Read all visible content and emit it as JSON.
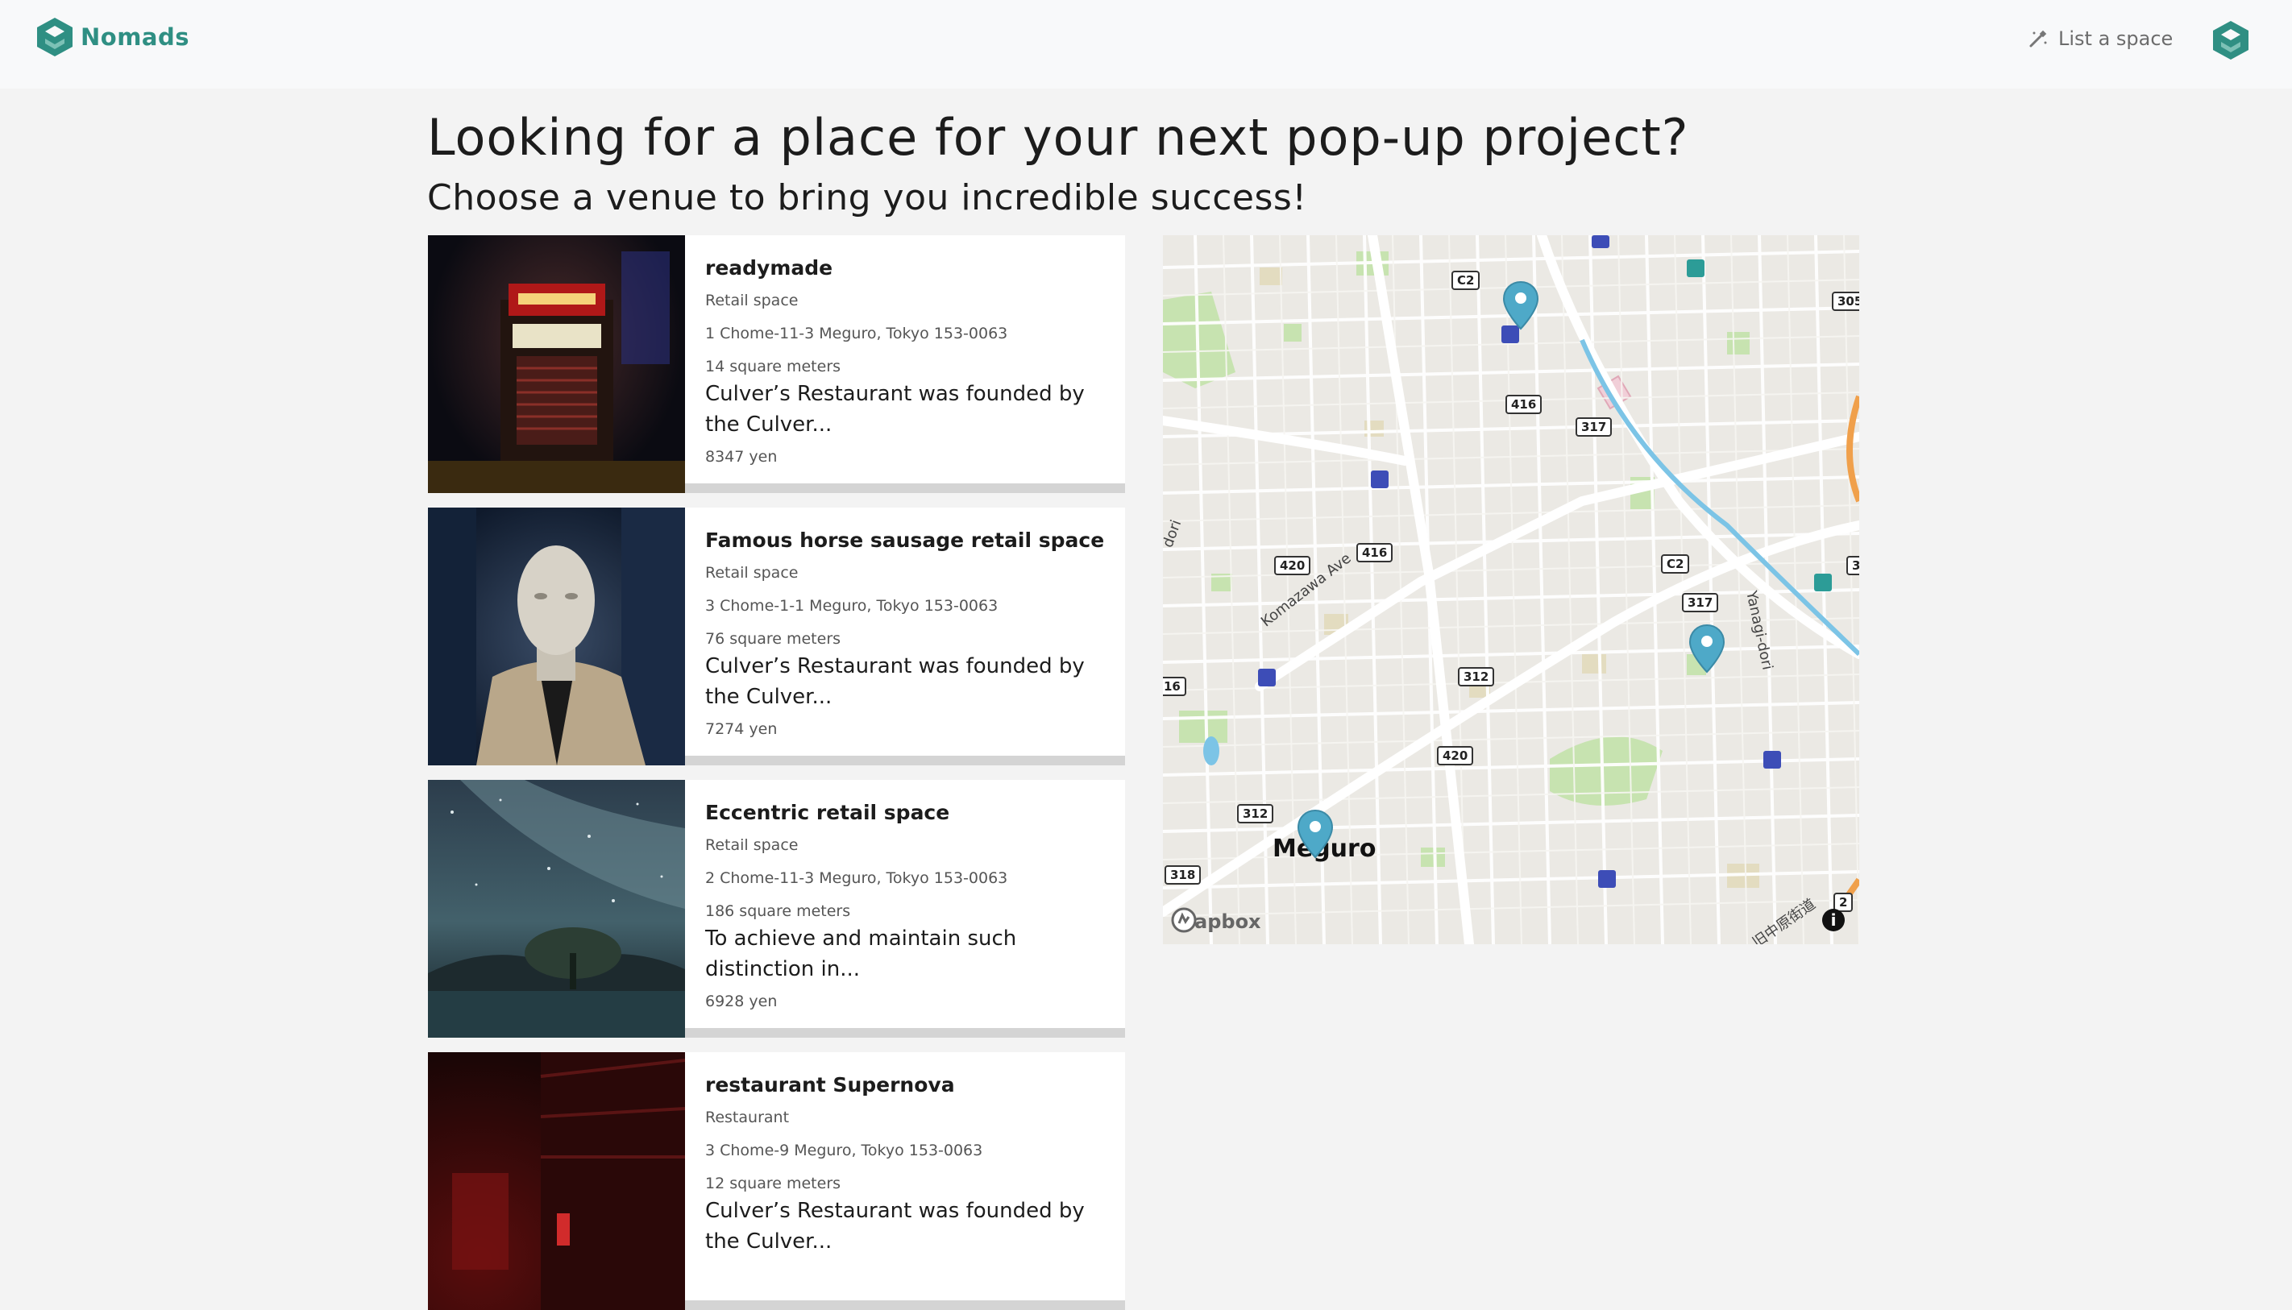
{
  "header": {
    "brand_name": "Nomads",
    "list_space_label": "List a space"
  },
  "hero": {
    "title": "Looking for a place for your next pop-up project?",
    "subtitle": "Choose a venue to bring you incredible success!"
  },
  "listings": [
    {
      "title": "readymade",
      "type": "Retail space",
      "address": "1 Chome-11-3 Meguro, Tokyo 153-0063",
      "size": "14 square meters",
      "description": "Culver’s Restaurant was founded by the Culver...",
      "price": "8347 yen"
    },
    {
      "title": "Famous horse sausage retail space",
      "type": "Retail space",
      "address": "3 Chome-1-1 Meguro, Tokyo 153-0063",
      "size": "76 square meters",
      "description": "Culver’s Restaurant was founded by the Culver...",
      "price": "7274 yen"
    },
    {
      "title": "Eccentric retail space",
      "type": "Retail space",
      "address": "2 Chome-11-3 Meguro, Tokyo 153-0063",
      "size": "186 square meters",
      "description": "To achieve and maintain such distinction in...",
      "price": "6928 yen"
    },
    {
      "title": "restaurant Supernova",
      "type": "Restaurant",
      "address": "3 Chome-9 Meguro, Tokyo 153-0063",
      "size": "12 square meters",
      "description": "Culver’s Restaurant was founded by the Culver...",
      "price": ""
    }
  ],
  "map": {
    "city_label": "Meguro",
    "attribution": "mapbox",
    "info_symbol": "i",
    "streets": [
      "Komazawa Ave",
      "Yanagi-dori",
      "旧中原街道",
      "dori"
    ],
    "route_shields": [
      "C2",
      "416",
      "317",
      "420",
      "416",
      "C2",
      "317",
      "312",
      "420",
      "312",
      "318",
      "305",
      "2",
      "16",
      "3"
    ],
    "pin_color": "#4ea9c8"
  },
  "colors": {
    "brand": "#2f8f83",
    "background": "#f3f3f3",
    "card_divider": "#d4d4d4"
  }
}
